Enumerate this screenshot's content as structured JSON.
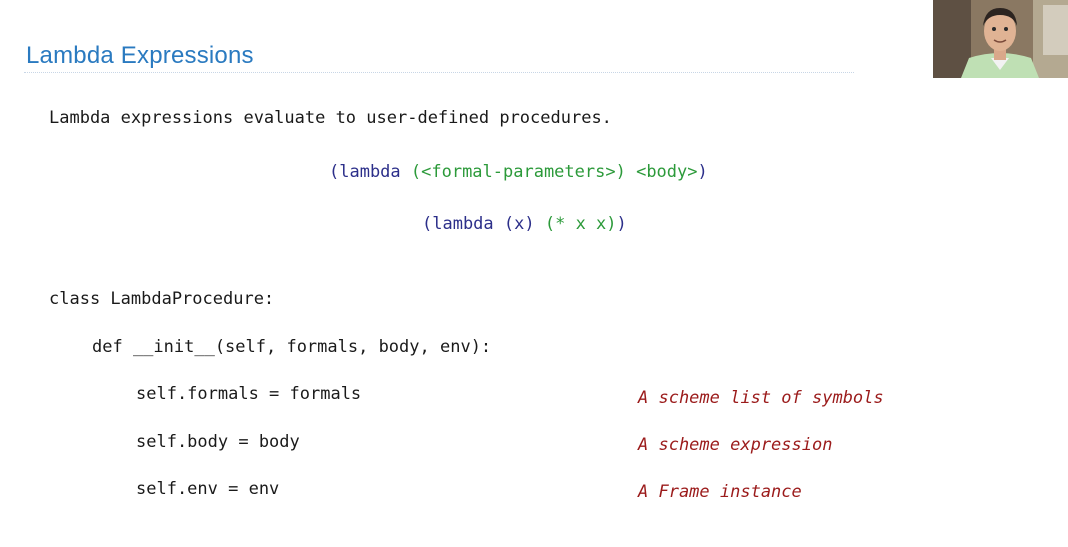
{
  "slide": {
    "title": "Lambda Expressions",
    "intro": "Lambda expressions evaluate to user-defined procedures.",
    "syntax": {
      "open": "(lambda ",
      "formals": "(<formal-parameters>)",
      "space": " ",
      "body": "<body>",
      "close": ")"
    },
    "example": {
      "open": "(lambda ",
      "formals": "(x)",
      "space": " ",
      "body": "(* x x)",
      "close": ")"
    },
    "code": {
      "class_line": "class LambdaProcedure:",
      "def_line": "def __init__(self, formals, body, env):",
      "line1": "self.formals = formals",
      "line2": "self.body = body",
      "line3": "self.env = env"
    },
    "comments": {
      "c1": "A scheme list of symbols",
      "c2": "A scheme expression",
      "c3": "A Frame instance"
    }
  },
  "colors": {
    "title": "#2a7ac0",
    "keyword": "#2c2f8a",
    "highlight": "#2c9a3a",
    "comment": "#9b1b1b"
  },
  "icons": {
    "webcam": "presenter-video-thumbnail"
  }
}
